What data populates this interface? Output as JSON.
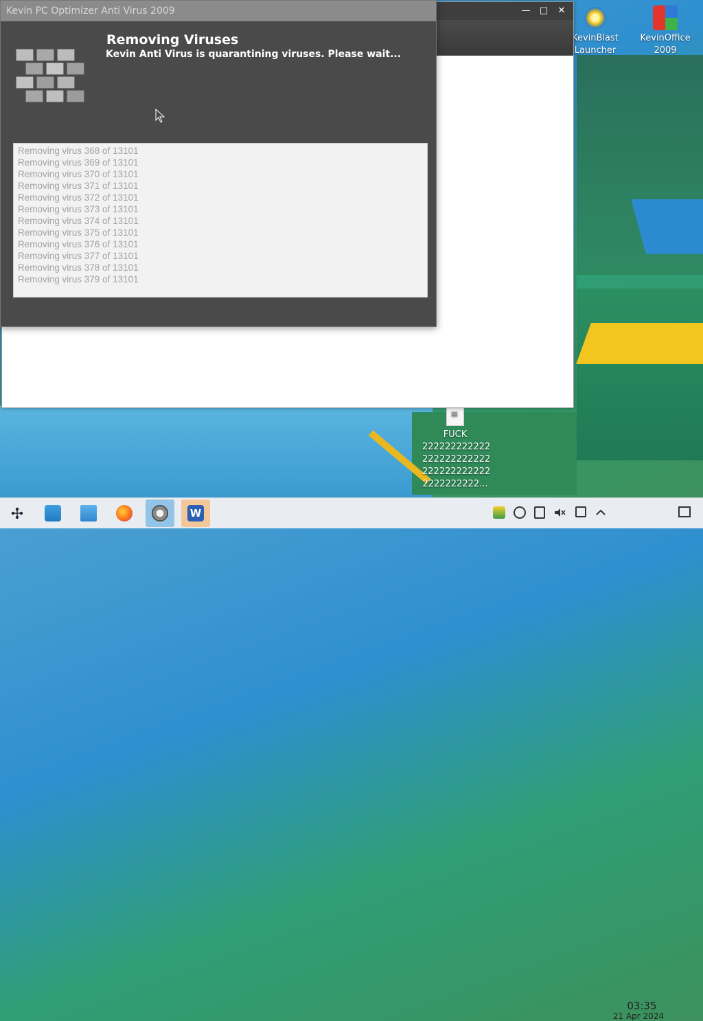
{
  "desktop_icons": [
    {
      "label": "KevinBlast Launcher"
    },
    {
      "label": "KevinOffice 2009"
    },
    {
      "label": "FUCK 2222222222222222222222222222222222222222222222222..."
    }
  ],
  "desktop_file_lines": [
    "FUCK",
    "222222222222",
    "222222222222",
    "222222222222",
    "2222222222..."
  ],
  "app": {
    "title": "Kevin PC Optimizer Anti Virus 2009",
    "heading": "Removing Viruses",
    "subheading": "Kevin Anti Virus is quarantining viruses. Please wait...",
    "log_lines": [
      "Removing virus 368 of 13101",
      "Removing virus 369 of 13101",
      "Removing virus 370 of 13101",
      "Removing virus 371 of 13101",
      "Removing virus 372 of 13101",
      "Removing virus 373 of 13101",
      "Removing virus 374 of 13101",
      "Removing virus 375 of 13101",
      "Removing virus 376 of 13101",
      "Removing virus 377 of 13101",
      "Removing virus 378 of 13101",
      "Removing virus 379 of 13101"
    ]
  },
  "back_window": {
    "minimize": "—",
    "maximize": "□",
    "close": "✕"
  },
  "taskbar": {
    "time": "03:35",
    "date": "21 Apr 2024",
    "apps": [
      "launcher-icon",
      "store-icon",
      "files-icon",
      "firefox-icon",
      "speedometer-icon",
      "word-icon"
    ],
    "tray": [
      "kevin-tray-icon",
      "network-icon",
      "clipboard-icon",
      "volume-muted-icon",
      "updates-icon",
      "chevron-up-icon",
      "show-desktop-icon"
    ]
  },
  "colors": {
    "accent_active": "#93c3e6",
    "accent_active2": "#f3c79a"
  }
}
